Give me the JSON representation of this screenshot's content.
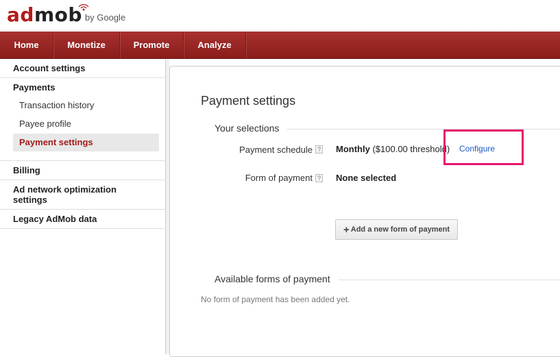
{
  "brand": {
    "logo_ad": "ad",
    "logo_mob": "mob",
    "logo_by": "by Google",
    "accent_color": "#a11d1b"
  },
  "nav": {
    "items": [
      {
        "label": "Home"
      },
      {
        "label": "Monetize"
      },
      {
        "label": "Promote"
      },
      {
        "label": "Analyze"
      }
    ]
  },
  "sidebar": {
    "account_settings": "Account settings",
    "payments": "Payments",
    "transaction_history": "Transaction history",
    "payee_profile": "Payee profile",
    "payment_settings": "Payment settings",
    "billing": "Billing",
    "ad_network_line1": "Ad network optimization",
    "ad_network_line2": "settings",
    "legacy": "Legacy AdMob data"
  },
  "main": {
    "title": "Payment settings",
    "your_selections": "Your selections",
    "payment_schedule_label": "Payment schedule",
    "help_glyph": "?",
    "payment_schedule_value_bold": "Monthly",
    "payment_schedule_value_rest": "($100.00 threshold)",
    "configure": "Configure",
    "form_of_payment_label": "Form of payment",
    "form_of_payment_value": "None selected",
    "add_button": "Add a new form of payment",
    "available_forms": "Available forms of payment",
    "no_form_text": "No form of payment has been added yet."
  }
}
